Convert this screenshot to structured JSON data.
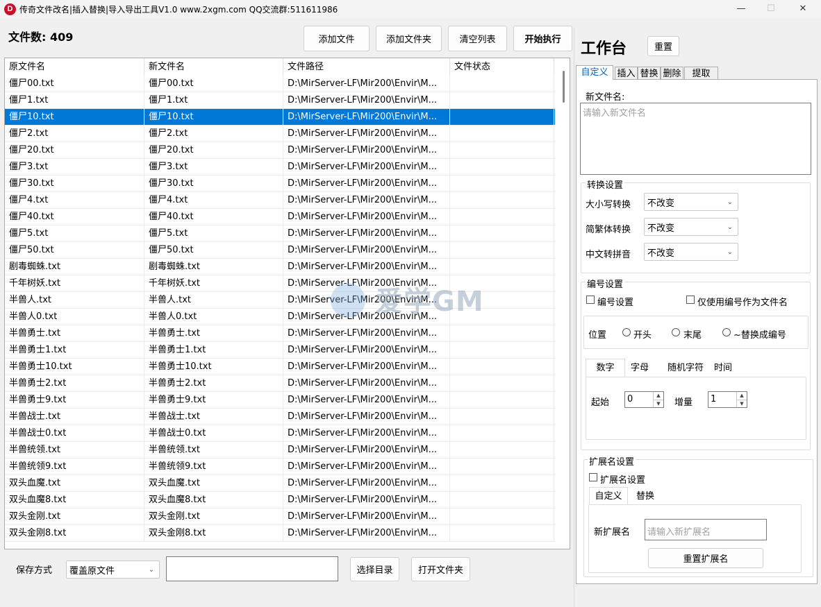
{
  "window": {
    "title": "传奇文件改名|插入替换|导入导出工具V1.0  www.2xgm.com QQ交流群:511611986",
    "icon_letter": "D",
    "minimize": "—",
    "maximize": "☐",
    "close": "✕"
  },
  "toolbar": {
    "file_count_label": "文件数: 409",
    "add_file": "添加文件",
    "add_folder": "添加文件夹",
    "clear_list": "清空列表",
    "start": "开始执行"
  },
  "table": {
    "columns": [
      "原文件名",
      "新文件名",
      "文件路径",
      "文件状态"
    ],
    "rows": [
      [
        "僵尸00.txt",
        "僵尸00.txt",
        "D:\\MirServer-LF\\Mir200\\Envir\\M...",
        ""
      ],
      [
        "僵尸1.txt",
        "僵尸1.txt",
        "D:\\MirServer-LF\\Mir200\\Envir\\M...",
        ""
      ],
      [
        "僵尸10.txt",
        "僵尸10.txt",
        "D:\\MirServer-LF\\Mir200\\Envir\\M...",
        ""
      ],
      [
        "僵尸2.txt",
        "僵尸2.txt",
        "D:\\MirServer-LF\\Mir200\\Envir\\M...",
        ""
      ],
      [
        "僵尸20.txt",
        "僵尸20.txt",
        "D:\\MirServer-LF\\Mir200\\Envir\\M...",
        ""
      ],
      [
        "僵尸3.txt",
        "僵尸3.txt",
        "D:\\MirServer-LF\\Mir200\\Envir\\M...",
        ""
      ],
      [
        "僵尸30.txt",
        "僵尸30.txt",
        "D:\\MirServer-LF\\Mir200\\Envir\\M...",
        ""
      ],
      [
        "僵尸4.txt",
        "僵尸4.txt",
        "D:\\MirServer-LF\\Mir200\\Envir\\M...",
        ""
      ],
      [
        "僵尸40.txt",
        "僵尸40.txt",
        "D:\\MirServer-LF\\Mir200\\Envir\\M...",
        ""
      ],
      [
        "僵尸5.txt",
        "僵尸5.txt",
        "D:\\MirServer-LF\\Mir200\\Envir\\M...",
        ""
      ],
      [
        "僵尸50.txt",
        "僵尸50.txt",
        "D:\\MirServer-LF\\Mir200\\Envir\\M...",
        ""
      ],
      [
        "剧毒蜘蛛.txt",
        "剧毒蜘蛛.txt",
        "D:\\MirServer-LF\\Mir200\\Envir\\M...",
        ""
      ],
      [
        "千年树妖.txt",
        "千年树妖.txt",
        "D:\\MirServer-LF\\Mir200\\Envir\\M...",
        ""
      ],
      [
        "半兽人.txt",
        "半兽人.txt",
        "D:\\MirServer-LF\\Mir200\\Envir\\M...",
        ""
      ],
      [
        "半兽人0.txt",
        "半兽人0.txt",
        "D:\\MirServer-LF\\Mir200\\Envir\\M...",
        ""
      ],
      [
        "半兽勇士.txt",
        "半兽勇士.txt",
        "D:\\MirServer-LF\\Mir200\\Envir\\M...",
        ""
      ],
      [
        "半兽勇士1.txt",
        "半兽勇士1.txt",
        "D:\\MirServer-LF\\Mir200\\Envir\\M...",
        ""
      ],
      [
        "半兽勇士10.txt",
        "半兽勇士10.txt",
        "D:\\MirServer-LF\\Mir200\\Envir\\M...",
        ""
      ],
      [
        "半兽勇士2.txt",
        "半兽勇士2.txt",
        "D:\\MirServer-LF\\Mir200\\Envir\\M...",
        ""
      ],
      [
        "半兽勇士9.txt",
        "半兽勇士9.txt",
        "D:\\MirServer-LF\\Mir200\\Envir\\M...",
        ""
      ],
      [
        "半兽战士.txt",
        "半兽战士.txt",
        "D:\\MirServer-LF\\Mir200\\Envir\\M...",
        ""
      ],
      [
        "半兽战士0.txt",
        "半兽战士0.txt",
        "D:\\MirServer-LF\\Mir200\\Envir\\M...",
        ""
      ],
      [
        "半兽统领.txt",
        "半兽统领.txt",
        "D:\\MirServer-LF\\Mir200\\Envir\\M...",
        ""
      ],
      [
        "半兽统领9.txt",
        "半兽统领9.txt",
        "D:\\MirServer-LF\\Mir200\\Envir\\M...",
        ""
      ],
      [
        "双头血魔.txt",
        "双头血魔.txt",
        "D:\\MirServer-LF\\Mir200\\Envir\\M...",
        ""
      ],
      [
        "双头血魔8.txt",
        "双头血魔8.txt",
        "D:\\MirServer-LF\\Mir200\\Envir\\M...",
        ""
      ],
      [
        "双头金刚.txt",
        "双头金刚.txt",
        "D:\\MirServer-LF\\Mir200\\Envir\\M...",
        ""
      ],
      [
        "双头金刚8.txt",
        "双头金刚8.txt",
        "D:\\MirServer-LF\\Mir200\\Envir\\M...",
        ""
      ]
    ],
    "selected_index": 2
  },
  "watermark": {
    "text": "爱学GM"
  },
  "bottom": {
    "save_mode_label": "保存方式",
    "save_mode_value": "覆盖原文件",
    "dir_value": "",
    "choose_dir": "选择目录",
    "open_folder": "打开文件夹"
  },
  "workbench": {
    "title": "工作台",
    "reset": "重置",
    "tabs": [
      "自定义",
      "插入",
      "替换",
      "删除",
      "提取"
    ],
    "active_tab": 0,
    "new_name_label": "新文件名:",
    "new_name_placeholder": "请输入新文件名",
    "convert": {
      "legend": "转换设置",
      "case_label": "大小写转换",
      "case_value": "不改变",
      "sc_label": "简繁体转换",
      "sc_value": "不改变",
      "pinyin_label": "中文转拼音",
      "pinyin_value": "不改变"
    },
    "numbering": {
      "legend": "编号设置",
      "enable_label": "编号设置",
      "only_number_label": "仅使用编号作为文件名",
      "position_label": "位置",
      "pos_start": "开头",
      "pos_end": "末尾",
      "pos_replace": "~替换成编号",
      "subtabs": [
        "数字",
        "字母",
        "随机字符",
        "时间"
      ],
      "start_label": "起始",
      "start_value": "0",
      "step_label": "增量",
      "step_value": "1"
    },
    "extension": {
      "legend": "扩展名设置",
      "enable_label": "扩展名设置",
      "subtabs": [
        "自定义",
        "替换"
      ],
      "new_ext_label": "新扩展名",
      "new_ext_placeholder": "请输入新扩展名",
      "reset_ext": "重置扩展名"
    }
  },
  "colors": {
    "selection": "#0078d7",
    "active_tab_text": "#0063b1",
    "brand_icon": "#c8102e"
  }
}
